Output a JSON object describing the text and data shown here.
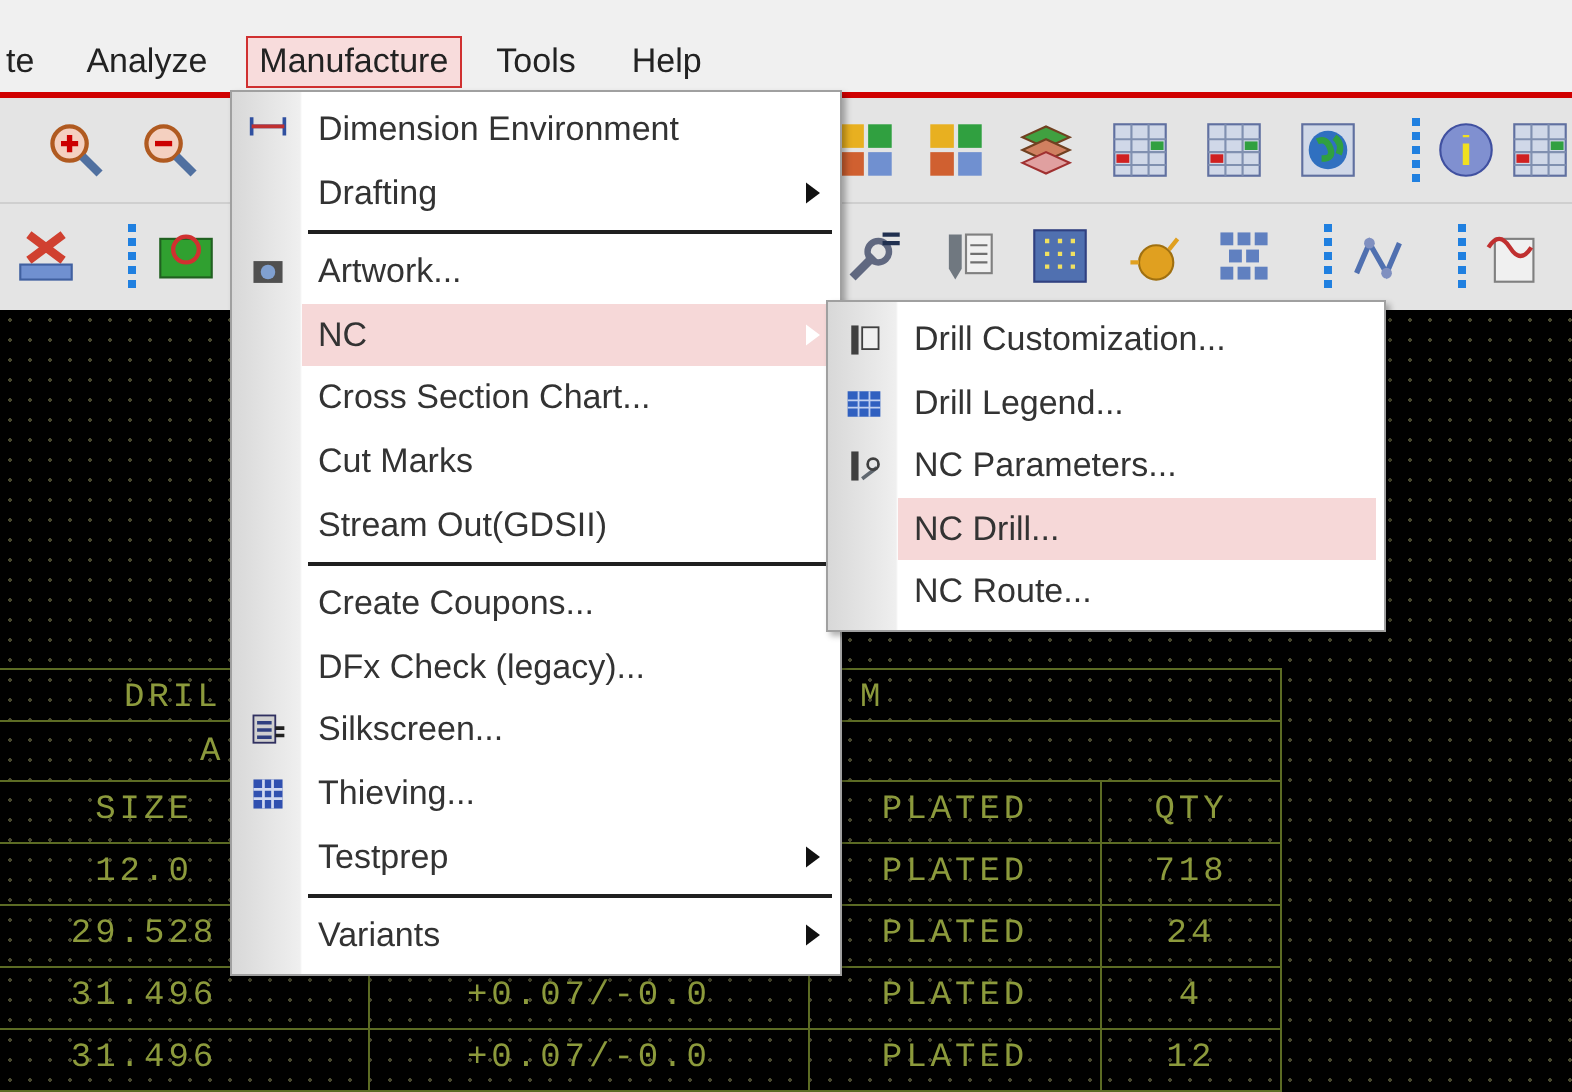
{
  "menu_bar": [
    {
      "label": "te",
      "selected": false
    },
    {
      "label": "Analyze",
      "selected": false
    },
    {
      "label": "Manufacture",
      "selected": true
    },
    {
      "label": "Tools",
      "selected": false
    },
    {
      "label": "Help",
      "selected": false
    }
  ],
  "manufacture_menu": [
    {
      "kind": "item",
      "label": "Dimension Environment",
      "submenu": false,
      "selected": false
    },
    {
      "kind": "item",
      "label": "Drafting",
      "submenu": true,
      "selected": false
    },
    {
      "kind": "separator"
    },
    {
      "kind": "item",
      "label": "Artwork...",
      "submenu": false,
      "selected": false
    },
    {
      "kind": "item",
      "label": "NC",
      "submenu": true,
      "selected": true
    },
    {
      "kind": "item",
      "label": "Cross Section Chart...",
      "submenu": false,
      "selected": false
    },
    {
      "kind": "item",
      "label": "Cut Marks",
      "submenu": false,
      "selected": false
    },
    {
      "kind": "item",
      "label": "Stream Out(GDSII)",
      "submenu": false,
      "selected": false
    },
    {
      "kind": "separator"
    },
    {
      "kind": "item",
      "label": "Create Coupons...",
      "submenu": false,
      "selected": false
    },
    {
      "kind": "item",
      "label": "DFx Check (legacy)...",
      "submenu": false,
      "selected": false
    },
    {
      "kind": "item",
      "label": "Silkscreen...",
      "submenu": false,
      "selected": false
    },
    {
      "kind": "item",
      "label": "Thieving...",
      "submenu": false,
      "selected": false
    },
    {
      "kind": "item",
      "label": "Testprep",
      "submenu": true,
      "selected": false
    },
    {
      "kind": "separator"
    },
    {
      "kind": "item",
      "label": "Variants",
      "submenu": true,
      "selected": false
    }
  ],
  "nc_submenu": [
    {
      "label": "Drill Customization...",
      "selected": false
    },
    {
      "label": "Drill Legend...",
      "selected": false
    },
    {
      "label": "NC Parameters...",
      "selected": false
    },
    {
      "label": "NC Drill...",
      "selected": true
    },
    {
      "label": "NC Route...",
      "selected": false
    }
  ],
  "drill_chart": {
    "title_row": [
      "DRIL",
      "M"
    ],
    "units_row": "A",
    "rows": [
      [
        "SIZE",
        "",
        "PLATED",
        "QTY"
      ],
      [
        "12.0",
        "",
        "PLATED",
        "718"
      ],
      [
        "29.528",
        "",
        "PLATED",
        "24"
      ],
      [
        "31.496",
        "+0.07/-0.0",
        "PLATED",
        "4"
      ],
      [
        "31.496",
        "+0.07/-0.0",
        "PLATED",
        "12"
      ]
    ]
  }
}
